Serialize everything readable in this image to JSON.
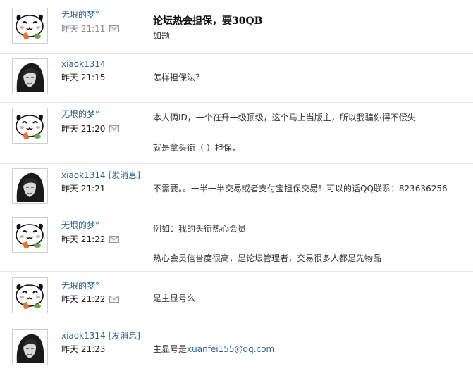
{
  "posts": [
    {
      "username": "无垠的梦°",
      "time": "昨天 21:11",
      "title": "论坛热会担保，要30QB",
      "lines": [
        "如题"
      ],
      "avatar_icon": "panda-avatar-icon",
      "mail_icon": "envelope-icon"
    },
    {
      "username": "xiaok1314",
      "time": "昨天 21:15",
      "lines": [
        "怎样担保法？"
      ],
      "avatar_icon": "dark-hair-avatar-icon"
    },
    {
      "username": "无垠的梦°",
      "time": "昨天 21:20",
      "lines": [
        "本人俩ID，一个在升一级顶级，这个马上当版主，所以我骗你得不偿失",
        "就是拿头衔（ ）担保，"
      ],
      "avatar_icon": "panda-avatar-icon",
      "mail_icon": "envelope-icon"
    },
    {
      "username": "xiaok1314",
      "send_msg": "[发消息]",
      "time": "昨天 21:21",
      "lines": [
        "不需要。。一半一半交易或者支付宝担保交易！可以的话QQ联系：823636256"
      ],
      "avatar_icon": "dark-hair-avatar-icon"
    },
    {
      "username": "无垠的梦°",
      "time": "昨天 21:22",
      "lines": [
        "例如：我的头衔热心会员",
        "热心会员信誉度很高，是论坛管理者，交易很多人都是先物品"
      ],
      "avatar_icon": "panda-avatar-icon",
      "mail_icon": "envelope-icon"
    },
    {
      "username": "无垠的梦°",
      "time": "昨天 21:22",
      "lines": [
        "是主显号么"
      ],
      "avatar_icon": "panda-avatar-icon",
      "mail_icon": "envelope-icon"
    },
    {
      "username": "xiaok1314",
      "send_msg": "[发消息]",
      "time": "昨天 21:23",
      "line_prefix": "主显号是",
      "email": "xuanfei155@qq.com",
      "avatar_icon": "dark-hair-avatar-icon"
    }
  ],
  "colors": {
    "link": "#2a6496",
    "separator": "#e6e6e6"
  }
}
